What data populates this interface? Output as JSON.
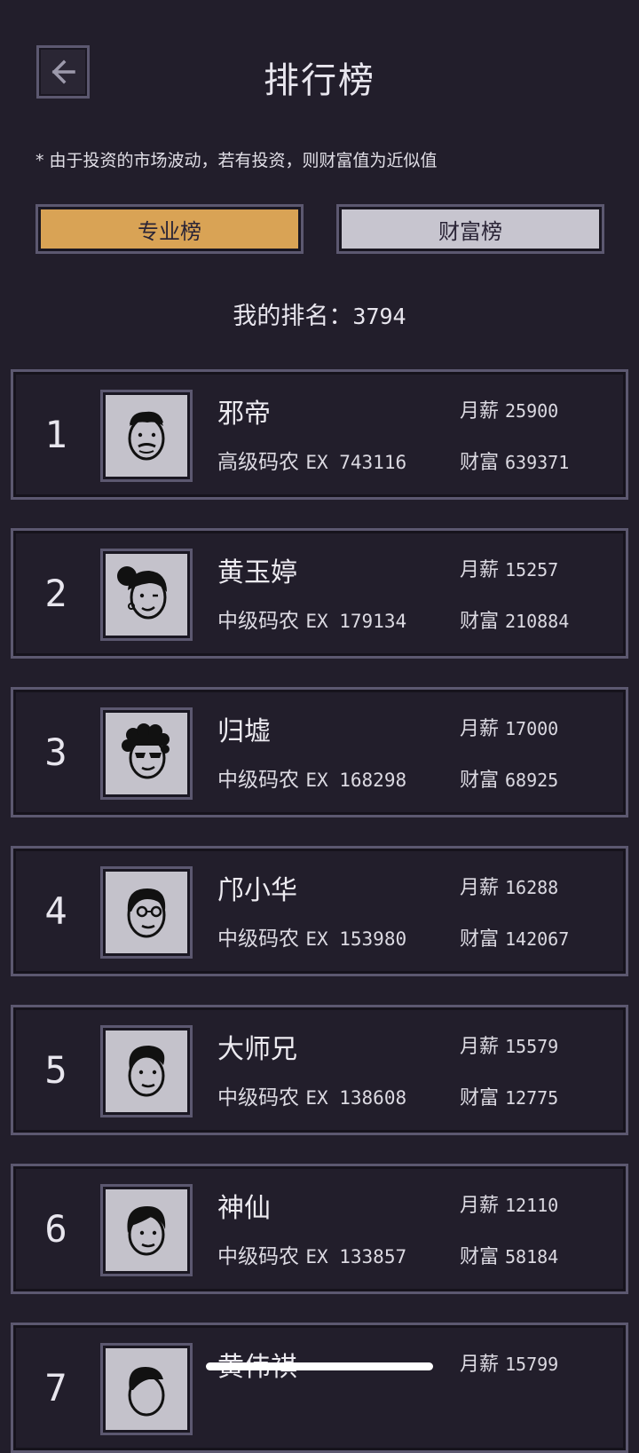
{
  "header": {
    "title": "排行榜",
    "note": "* 由于投资的市场波动，若有投资，则财富值为近似值"
  },
  "tabs": [
    {
      "label": "专业榜",
      "active": true
    },
    {
      "label": "财富榜",
      "active": false
    }
  ],
  "my_rank": {
    "label": "我的排名：",
    "value": "3794"
  },
  "labels": {
    "salary": "月薪",
    "wealth": "财富"
  },
  "colors": {
    "accent": "#d9a355",
    "background": "#221e2b",
    "border": "#5c5870"
  },
  "rows": [
    {
      "rank": "1",
      "name": "邪帝",
      "level": "高级码农",
      "ex": "EX 743116",
      "salary": "25900",
      "wealth": "639371",
      "avatar": "man-mustache-icon"
    },
    {
      "rank": "2",
      "name": "黄玉婷",
      "level": "中级码农",
      "ex": "EX 179134",
      "salary": "15257",
      "wealth": "210884",
      "avatar": "woman-bun-icon"
    },
    {
      "rank": "3",
      "name": "归墟",
      "level": "中级码农",
      "ex": "EX 168298",
      "salary": "17000",
      "wealth": "68925",
      "avatar": "curly-sunglasses-icon"
    },
    {
      "rank": "4",
      "name": "邝小华",
      "level": "中级码农",
      "ex": "EX 153980",
      "salary": "16288",
      "wealth": "142067",
      "avatar": "man-glasses-icon"
    },
    {
      "rank": "5",
      "name": "大师兄",
      "level": "中级码农",
      "ex": "EX 138608",
      "salary": "15579",
      "wealth": "12775",
      "avatar": "man-quiff-icon"
    },
    {
      "rank": "6",
      "name": "神仙",
      "level": "中级码农",
      "ex": "EX 133857",
      "salary": "12110",
      "wealth": "58184",
      "avatar": "man-hair-icon"
    },
    {
      "rank": "7",
      "name": "黄伟祺",
      "level": "",
      "ex": "",
      "salary": "15799",
      "wealth": "",
      "avatar": "man-side-icon"
    }
  ]
}
